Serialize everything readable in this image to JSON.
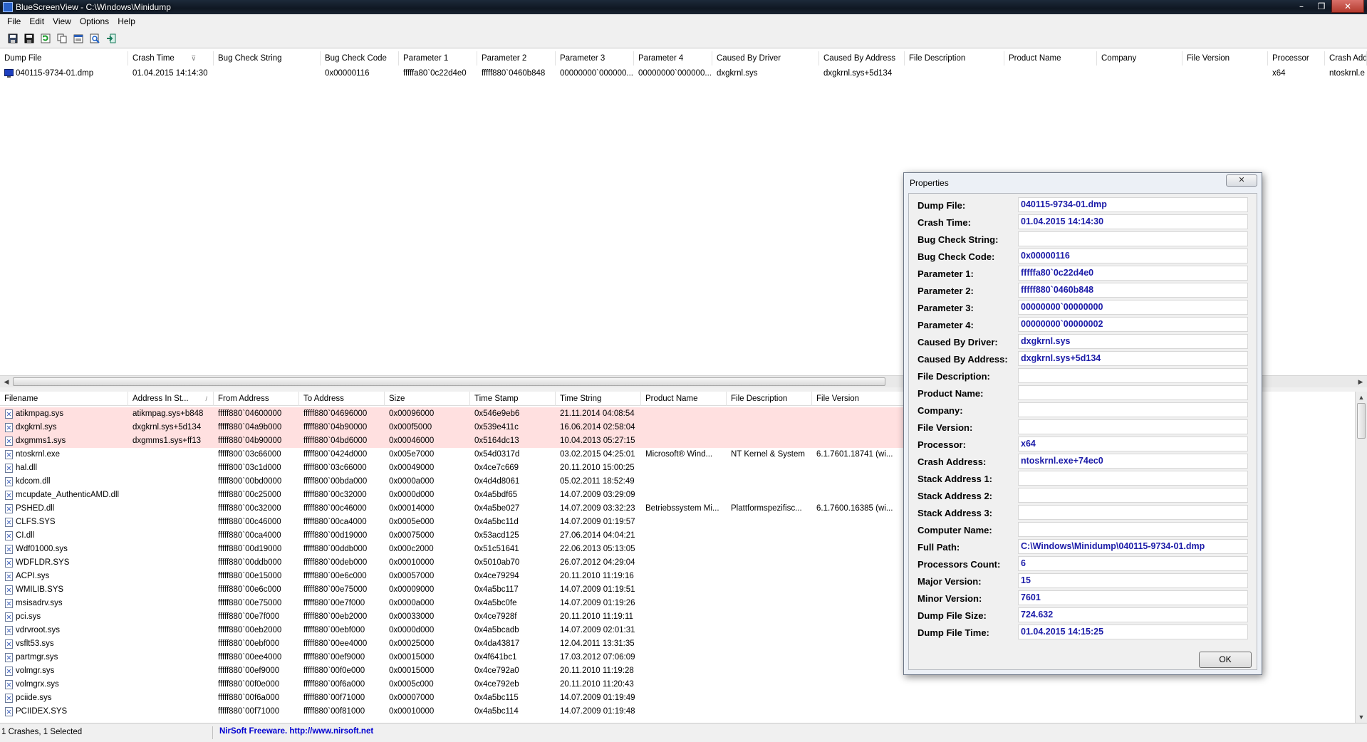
{
  "window": {
    "title": "BlueScreenView  -  C:\\Windows\\Minidump"
  },
  "window_buttons": [
    "–",
    "❐",
    "✕"
  ],
  "menu": [
    "File",
    "Edit",
    "View",
    "Options",
    "Help"
  ],
  "toolbar": [
    "save-icon",
    "save-selected-icon",
    "refresh-icon",
    "copy-icon",
    "properties-icon",
    "find-icon",
    "exit-icon"
  ],
  "upper": {
    "columns": [
      "Dump File",
      "Crash Time",
      "Bug Check String",
      "Bug Check Code",
      "Parameter 1",
      "Parameter 2",
      "Parameter 3",
      "Parameter 4",
      "Caused By Driver",
      "Caused By Address",
      "File Description",
      "Product Name",
      "Company",
      "File Version",
      "Processor",
      "Crash Add"
    ],
    "sort_indicator": "⊽",
    "rows": [
      [
        "040115-9734-01.dmp",
        "01.04.2015 14:14:30",
        "",
        "0x00000116",
        "fffffa80`0c22d4e0",
        "fffff880`0460b848",
        "00000000`000000...",
        "00000000`000000...",
        "dxgkrnl.sys",
        "dxgkrnl.sys+5d134",
        "",
        "",
        "",
        "",
        "x64",
        "ntoskrnl.e"
      ]
    ]
  },
  "lower": {
    "columns": [
      "Filename",
      "Address In St...",
      "From Address",
      "To Address",
      "Size",
      "Time Stamp",
      "Time String",
      "Product Name",
      "File Description",
      "File Version"
    ],
    "sort_indicator": "/",
    "rows": [
      [
        "atikmpag.sys",
        "atikmpag.sys+b848",
        "fffff880`04600000",
        "fffff880`04696000",
        "0x00096000",
        "0x546e9eb6",
        "21.11.2014 04:08:54",
        "",
        "",
        ""
      ],
      [
        "dxgkrnl.sys",
        "dxgkrnl.sys+5d134",
        "fffff880`04a9b000",
        "fffff880`04b90000",
        "0x000f5000",
        "0x539e411c",
        "16.06.2014 02:58:04",
        "",
        "",
        ""
      ],
      [
        "dxgmms1.sys",
        "dxgmms1.sys+ff13",
        "fffff880`04b90000",
        "fffff880`04bd6000",
        "0x00046000",
        "0x5164dc13",
        "10.04.2013 05:27:15",
        "",
        "",
        ""
      ],
      [
        "ntoskrnl.exe",
        "",
        "fffff800`03c66000",
        "fffff800`0424d000",
        "0x005e7000",
        "0x54d0317d",
        "03.02.2015 04:25:01",
        "Microsoft® Wind...",
        "NT Kernel & System",
        "6.1.7601.18741 (wi..."
      ],
      [
        "hal.dll",
        "",
        "fffff800`03c1d000",
        "fffff800`03c66000",
        "0x00049000",
        "0x4ce7c669",
        "20.11.2010 15:00:25",
        "",
        "",
        ""
      ],
      [
        "kdcom.dll",
        "",
        "fffff800`00bd0000",
        "fffff800`00bda000",
        "0x0000a000",
        "0x4d4d8061",
        "05.02.2011 18:52:49",
        "",
        "",
        ""
      ],
      [
        "mcupdate_AuthenticAMD.dll",
        "",
        "fffff880`00c25000",
        "fffff880`00c32000",
        "0x0000d000",
        "0x4a5bdf65",
        "14.07.2009 03:29:09",
        "",
        "",
        ""
      ],
      [
        "PSHED.dll",
        "",
        "fffff880`00c32000",
        "fffff880`00c46000",
        "0x00014000",
        "0x4a5be027",
        "14.07.2009 03:32:23",
        "Betriebssystem Mi...",
        "Plattformspezifisc...",
        "6.1.7600.16385 (wi..."
      ],
      [
        "CLFS.SYS",
        "",
        "fffff880`00c46000",
        "fffff880`00ca4000",
        "0x0005e000",
        "0x4a5bc11d",
        "14.07.2009 01:19:57",
        "",
        "",
        ""
      ],
      [
        "CI.dll",
        "",
        "fffff880`00ca4000",
        "fffff880`00d19000",
        "0x00075000",
        "0x53acd125",
        "27.06.2014 04:04:21",
        "",
        "",
        ""
      ],
      [
        "Wdf01000.sys",
        "",
        "fffff880`00d19000",
        "fffff880`00ddb000",
        "0x000c2000",
        "0x51c51641",
        "22.06.2013 05:13:05",
        "",
        "",
        ""
      ],
      [
        "WDFLDR.SYS",
        "",
        "fffff880`00ddb000",
        "fffff880`00deb000",
        "0x00010000",
        "0x5010ab70",
        "26.07.2012 04:29:04",
        "",
        "",
        ""
      ],
      [
        "ACPI.sys",
        "",
        "fffff880`00e15000",
        "fffff880`00e6c000",
        "0x00057000",
        "0x4ce79294",
        "20.11.2010 11:19:16",
        "",
        "",
        ""
      ],
      [
        "WMILIB.SYS",
        "",
        "fffff880`00e6c000",
        "fffff880`00e75000",
        "0x00009000",
        "0x4a5bc117",
        "14.07.2009 01:19:51",
        "",
        "",
        ""
      ],
      [
        "msisadrv.sys",
        "",
        "fffff880`00e75000",
        "fffff880`00e7f000",
        "0x0000a000",
        "0x4a5bc0fe",
        "14.07.2009 01:19:26",
        "",
        "",
        ""
      ],
      [
        "pci.sys",
        "",
        "fffff880`00e7f000",
        "fffff880`00eb2000",
        "0x00033000",
        "0x4ce7928f",
        "20.11.2010 11:19:11",
        "",
        "",
        ""
      ],
      [
        "vdrvroot.sys",
        "",
        "fffff880`00eb2000",
        "fffff880`00ebf000",
        "0x0000d000",
        "0x4a5bcadb",
        "14.07.2009 02:01:31",
        "",
        "",
        ""
      ],
      [
        "vsflt53.sys",
        "",
        "fffff880`00ebf000",
        "fffff880`00ee4000",
        "0x00025000",
        "0x4da43817",
        "12.04.2011 13:31:35",
        "",
        "",
        ""
      ],
      [
        "partmgr.sys",
        "",
        "fffff880`00ee4000",
        "fffff880`00ef9000",
        "0x00015000",
        "0x4f641bc1",
        "17.03.2012 07:06:09",
        "",
        "",
        ""
      ],
      [
        "volmgr.sys",
        "",
        "fffff880`00ef9000",
        "fffff880`00f0e000",
        "0x00015000",
        "0x4ce792a0",
        "20.11.2010 11:19:28",
        "",
        "",
        ""
      ],
      [
        "volmgrx.sys",
        "",
        "fffff880`00f0e000",
        "fffff880`00f6a000",
        "0x0005c000",
        "0x4ce792eb",
        "20.11.2010 11:20:43",
        "",
        "",
        ""
      ],
      [
        "pciide.sys",
        "",
        "fffff880`00f6a000",
        "fffff880`00f71000",
        "0x00007000",
        "0x4a5bc115",
        "14.07.2009 01:19:49",
        "",
        "",
        ""
      ],
      [
        "PCIIDEX.SYS",
        "",
        "fffff880`00f71000",
        "fffff880`00f81000",
        "0x00010000",
        "0x4a5bc114",
        "14.07.2009 01:19:48",
        "",
        "",
        ""
      ]
    ]
  },
  "status": {
    "count": "1 Crashes, 1 Selected",
    "link": "NirSoft Freeware.  http://www.nirsoft.net"
  },
  "dialog": {
    "title": "Properties",
    "close": "✕",
    "ok": "OK",
    "fields": [
      {
        "label": "Dump File:",
        "value": "040115-9734-01.dmp"
      },
      {
        "label": "Crash Time:",
        "value": "01.04.2015 14:14:30"
      },
      {
        "label": "Bug Check String:",
        "value": ""
      },
      {
        "label": "Bug Check Code:",
        "value": "0x00000116"
      },
      {
        "label": "Parameter 1:",
        "value": "fffffa80`0c22d4e0"
      },
      {
        "label": "Parameter 2:",
        "value": "fffff880`0460b848"
      },
      {
        "label": "Parameter 3:",
        "value": "00000000`00000000"
      },
      {
        "label": "Parameter 4:",
        "value": "00000000`00000002"
      },
      {
        "label": "Caused By Driver:",
        "value": "dxgkrnl.sys"
      },
      {
        "label": "Caused By Address:",
        "value": "dxgkrnl.sys+5d134"
      },
      {
        "label": "File Description:",
        "value": ""
      },
      {
        "label": "Product Name:",
        "value": ""
      },
      {
        "label": "Company:",
        "value": ""
      },
      {
        "label": "File Version:",
        "value": ""
      },
      {
        "label": "Processor:",
        "value": "x64"
      },
      {
        "label": "Crash Address:",
        "value": "ntoskrnl.exe+74ec0"
      },
      {
        "label": "Stack Address 1:",
        "value": ""
      },
      {
        "label": "Stack Address 2:",
        "value": ""
      },
      {
        "label": "Stack Address 3:",
        "value": ""
      },
      {
        "label": "Computer Name:",
        "value": ""
      },
      {
        "label": "Full Path:",
        "value": "C:\\Windows\\Minidump\\040115-9734-01.dmp"
      },
      {
        "label": "Processors Count:",
        "value": "6"
      },
      {
        "label": "Major Version:",
        "value": "15"
      },
      {
        "label": "Minor Version:",
        "value": "7601"
      },
      {
        "label": "Dump File Size:",
        "value": "724.632"
      },
      {
        "label": "Dump File Time:",
        "value": "01.04.2015 14:15:25"
      }
    ]
  },
  "colors": {
    "highlight_row": "#ffe0e0",
    "field_text": "#1c1ca8",
    "link": "#0000d0"
  }
}
